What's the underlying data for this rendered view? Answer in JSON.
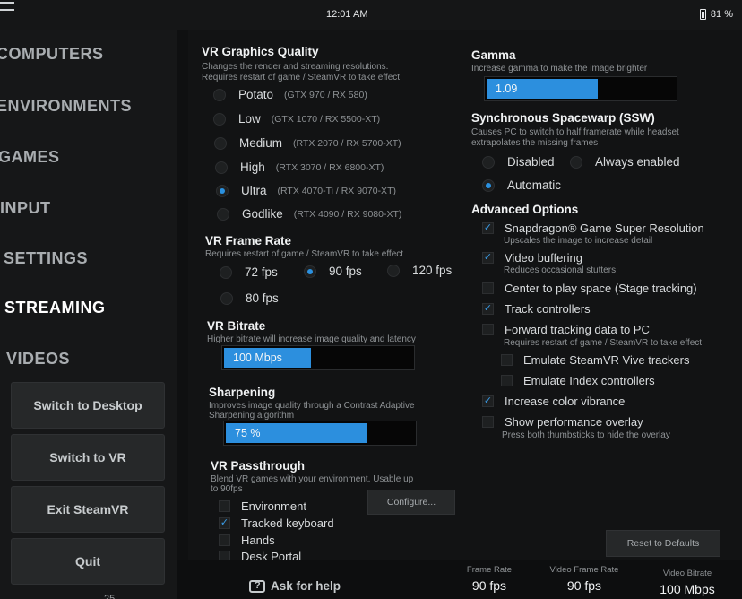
{
  "status_bar": {
    "time": "12:01 AM",
    "battery": "81 %"
  },
  "sidebar": {
    "nav": [
      {
        "label": "COMPUTERS"
      },
      {
        "label": "ENVIRONMENTS"
      },
      {
        "label": "GAMES"
      },
      {
        "label": "INPUT"
      },
      {
        "label": "SETTINGS"
      },
      {
        "label": "STREAMING",
        "active": true
      },
      {
        "label": "VIDEOS"
      }
    ],
    "buttons": [
      "Switch to Desktop",
      "Switch to VR",
      "Exit SteamVR",
      "Quit"
    ],
    "footer_partial": "25"
  },
  "graphics": {
    "title": "VR Graphics Quality",
    "desc1": "Changes the render and streaming resolutions.",
    "desc2": "Requires restart of game / SteamVR to take effect",
    "options": [
      {
        "label": "Potato",
        "note": "(GTX 970 / RX 580)"
      },
      {
        "label": "Low",
        "note": "(GTX 1070 / RX 5500-XT)"
      },
      {
        "label": "Medium",
        "note": "(RTX 2070 / RX 5700-XT)"
      },
      {
        "label": "High",
        "note": "(RTX 3070 / RX 6800-XT)"
      },
      {
        "label": "Ultra",
        "note": "(RTX 4070-Ti / RX 9070-XT)",
        "selected": true
      },
      {
        "label": "Godlike",
        "note": "(RTX 4090 / RX 9080-XT)"
      }
    ]
  },
  "framerate": {
    "title": "VR Frame Rate",
    "desc": "Requires restart of game / SteamVR to take effect",
    "options": [
      {
        "label": "72 fps"
      },
      {
        "label": "90 fps",
        "selected": true
      },
      {
        "label": "120 fps"
      },
      {
        "label": "80 fps"
      }
    ]
  },
  "bitrate": {
    "title": "VR Bitrate",
    "desc": "Higher bitrate will increase image quality and latency",
    "value_label": "100 Mbps",
    "fill_fraction": 0.47
  },
  "sharpening": {
    "title": "Sharpening",
    "desc1": "Improves image quality through a Contrast Adaptive",
    "desc2": "Sharpening algorithm",
    "value_label": "75 %",
    "fill_fraction": 0.75
  },
  "passthrough": {
    "title": "VR Passthrough",
    "desc1": "Blend VR games with your environment. Usable up",
    "desc2": "to 90fps",
    "items": [
      {
        "label": "Environment",
        "checked": false
      },
      {
        "label": "Tracked keyboard",
        "checked": true
      },
      {
        "label": "Hands",
        "checked": false
      },
      {
        "label": "Desk Portal",
        "checked": false
      }
    ],
    "configure_label": "Configure..."
  },
  "gamma": {
    "title": "Gamma",
    "desc": "Increase gamma to make the image brighter",
    "value_label": "1.09",
    "fill_fraction": 0.6
  },
  "ssw": {
    "title": "Synchronous Spacewarp (SSW)",
    "desc1": "Causes PC to switch to half framerate while headset",
    "desc2": "extrapolates the missing frames",
    "options": [
      {
        "label": "Disabled"
      },
      {
        "label": "Always enabled"
      },
      {
        "label": "Automatic",
        "selected": true
      }
    ]
  },
  "advanced": {
    "title": "Advanced Options",
    "items": [
      {
        "label": "Snapdragon® Game Super Resolution",
        "checked": true,
        "desc": "Upscales the image to increase detail"
      },
      {
        "label": "Video buffering",
        "checked": true,
        "desc": "Reduces occasional stutters"
      },
      {
        "label": "Center to play space (Stage tracking)",
        "checked": false
      },
      {
        "label": "Track controllers",
        "checked": true
      },
      {
        "label": "Forward tracking data to PC",
        "checked": false,
        "desc": "Requires restart of game / SteamVR to take effect"
      },
      {
        "label": "Emulate SteamVR Vive trackers",
        "checked": false
      },
      {
        "label": "Emulate Index controllers",
        "checked": false
      },
      {
        "label": "Increase color vibrance",
        "checked": true
      },
      {
        "label": "Show performance overlay",
        "checked": false,
        "desc": "Press both thumbsticks to hide the overlay"
      }
    ]
  },
  "reset_label": "Reset to Defaults",
  "bottom": {
    "help_label": "Ask for help",
    "stats": [
      {
        "label": "Frame Rate",
        "value": "90 fps"
      },
      {
        "label": "Video Frame Rate",
        "value": "90 fps"
      },
      {
        "label": "Video Bitrate",
        "value": "100 Mbps"
      }
    ]
  },
  "colors": {
    "accent": "#2c8fde",
    "background": "#121314",
    "sidebar": "#161718"
  },
  "icons": {
    "menu": "hamburger-icon",
    "battery": "battery-icon",
    "help": "help-icon",
    "check": "checkmark-icon"
  }
}
